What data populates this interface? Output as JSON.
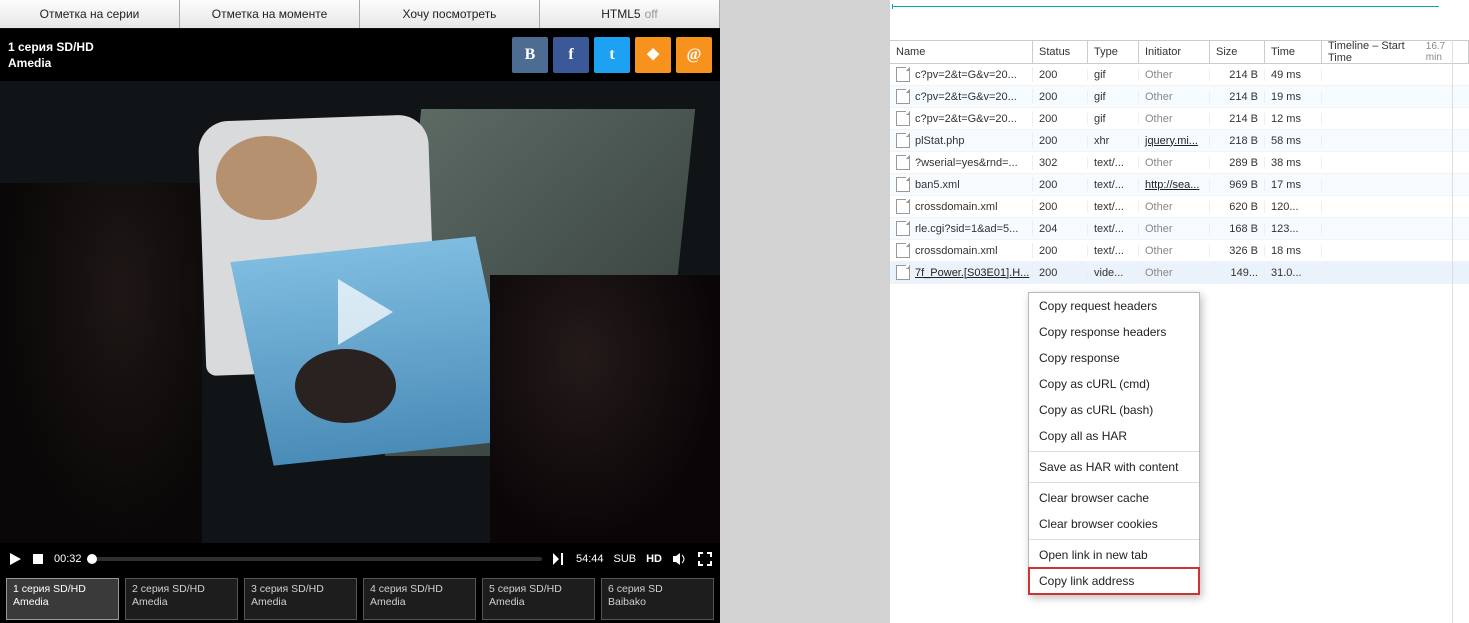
{
  "tabs": {
    "series": "Отметка на серии",
    "moment": "Отметка на моменте",
    "want": "Хочу посмотреть",
    "html5": "HTML5",
    "html5_off": "off"
  },
  "header": {
    "line1": "1 серия SD/HD",
    "line2": "Amedia"
  },
  "social": {
    "vk": "B",
    "fb": "f",
    "tw": "t",
    "ok": "❖",
    "at": "@"
  },
  "player": {
    "cur": "00:32",
    "dur": "54:44",
    "sub": "SUB",
    "hd": "HD"
  },
  "episodes": [
    {
      "l1": "1 серия SD/HD",
      "l2": "Amedia",
      "active": true
    },
    {
      "l1": "2 серия SD/HD",
      "l2": "Amedia"
    },
    {
      "l1": "3 серия SD/HD",
      "l2": "Amedia"
    },
    {
      "l1": "4 серия SD/HD",
      "l2": "Amedia"
    },
    {
      "l1": "5 серия SD/HD",
      "l2": "Amedia"
    },
    {
      "l1": "6 серия SD",
      "l2": "Baibako"
    }
  ],
  "net": {
    "columns": {
      "name": "Name",
      "status": "Status",
      "type": "Type",
      "initiator": "Initiator",
      "size": "Size",
      "time": "Time",
      "timeline": "Timeline – Start Time",
      "right": "16.7 min"
    },
    "rows": [
      {
        "name": "c?pv=2&t=G&v=20...",
        "status": "200",
        "type": "gif",
        "init": "Other",
        "size": "214 B",
        "time": "49 ms",
        "bar": {
          "l": 1,
          "w": 2,
          "c": "#0a6ab5"
        }
      },
      {
        "name": "c?pv=2&t=G&v=20...",
        "status": "200",
        "type": "gif",
        "init": "Other",
        "size": "214 B",
        "time": "19 ms",
        "bar": {
          "l": 1,
          "w": 2,
          "c": "#0a6ab5"
        }
      },
      {
        "name": "c?pv=2&t=G&v=20...",
        "status": "200",
        "type": "gif",
        "init": "Other",
        "size": "214 B",
        "time": "12 ms",
        "bar": {
          "l": 1,
          "w": 2,
          "c": "#0a6ab5"
        }
      },
      {
        "name": "plStat.php",
        "status": "200",
        "type": "xhr",
        "init": "jquery.mi...",
        "link": true,
        "size": "218 B",
        "time": "58 ms"
      },
      {
        "name": "?wserial=yes&rnd=...",
        "status": "302",
        "type": "text/...",
        "init": "Other",
        "size": "289 B",
        "time": "38 ms"
      },
      {
        "name": "ban5.xml",
        "status": "200",
        "type": "text/...",
        "init": "http://sea...",
        "link": true,
        "size": "969 B",
        "time": "17 ms"
      },
      {
        "name": "crossdomain.xml",
        "status": "200",
        "type": "text/...",
        "init": "Other",
        "size": "620 B",
        "time": "120..."
      },
      {
        "name": "rle.cgi?sid=1&ad=5...",
        "status": "204",
        "type": "text/...",
        "init": "Other",
        "size": "168 B",
        "time": "123..."
      },
      {
        "name": "crossdomain.xml",
        "status": "200",
        "type": "text/...",
        "init": "Other",
        "size": "326 B",
        "time": "18 ms"
      },
      {
        "name": "7f_Power.[S03E01].H...",
        "status": "200",
        "type": "vide...",
        "init": "Other",
        "size": "149...",
        "time": "31.0...",
        "sel": true,
        "underline": true
      }
    ]
  },
  "menu": {
    "g1": [
      "Copy request headers",
      "Copy response headers",
      "Copy response",
      "Copy as cURL (cmd)",
      "Copy as cURL (bash)",
      "Copy all as HAR"
    ],
    "g2": [
      "Save as HAR with content"
    ],
    "g3": [
      "Clear browser cache",
      "Clear browser cookies"
    ],
    "g4": [
      "Open link in new tab",
      "Copy link address"
    ]
  }
}
